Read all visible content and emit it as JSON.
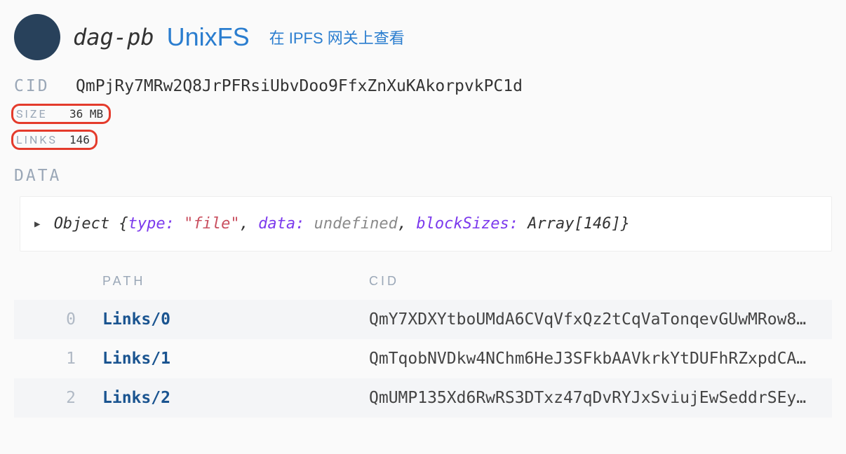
{
  "header": {
    "format": "dag-pb",
    "filesystem": "UnixFS",
    "gateway_link": "在 IPFS 网关上查看"
  },
  "info": {
    "cid_label": "CID",
    "cid_value": "QmPjRy7MRw2Q8JrPFRsiUbvDoo9FfxZnXuKAkorpvkPC1d",
    "size_label": "SIZE",
    "size_value": "36 MB",
    "links_label": "LINKS",
    "links_value": "146",
    "data_label": "DATA"
  },
  "object_inspector": {
    "keyword": "Object",
    "key_type": "type:",
    "val_type": "\"file\"",
    "key_data": "data:",
    "val_data": "undefined",
    "key_blocksizes": "blockSizes:",
    "val_blocksizes": "Array[146]"
  },
  "table": {
    "path_header": "PATH",
    "cid_header": "CID",
    "rows": [
      {
        "index": "0",
        "path": "Links/0",
        "cid": "QmY7XDXYtboUMdA6CVqVfxQz2tCqVaTonqevGUwMRow8…"
      },
      {
        "index": "1",
        "path": "Links/1",
        "cid": "QmTqobNVDkw4NChm6HeJ3SFkbAAVkrkYtDUFhRZxpdCA…"
      },
      {
        "index": "2",
        "path": "Links/2",
        "cid": "QmUMP135Xd6RwRS3DTxz47qDvRYJxSviujEwSeddrSEy…"
      }
    ]
  }
}
